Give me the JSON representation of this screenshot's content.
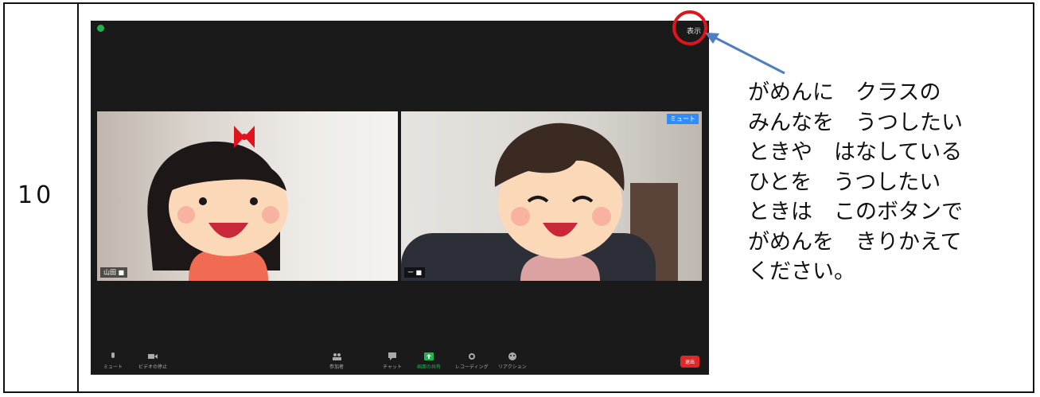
{
  "step": {
    "number": "10"
  },
  "zoom": {
    "view_switch_label": "表示",
    "participants": [
      {
        "name": "山田 ■",
        "role": "girl"
      },
      {
        "name": "ー  ■",
        "role": "boy",
        "badge": "ミュート"
      }
    ],
    "toolbar": {
      "items": [
        {
          "label": "ミュート",
          "icon": "microphone-icon"
        },
        {
          "label": "ビデオの停止",
          "icon": "video-camera-icon"
        },
        {
          "label": "参加者",
          "icon": "participants-icon"
        },
        {
          "label": "チャット",
          "icon": "chat-icon"
        },
        {
          "label": "画面の共有",
          "icon": "share-screen-icon"
        },
        {
          "label": "レコーディング",
          "icon": "record-icon"
        },
        {
          "label": "リアクション",
          "icon": "reaction-icon"
        }
      ],
      "participants_count": "2",
      "leave_label": "退出"
    },
    "colors": {
      "background": "#1a1a1a",
      "share": "#22b34a",
      "leave": "#e02828",
      "highlight": "#e0151a",
      "arrow": "#4f7fc0"
    }
  },
  "instruction": {
    "text": "がめんに　クラスの\nみんなを　うつしたい\nときや　はなしている\nひとを　うつしたい\nときは　このボタンで\nがめんを　きりかえて\nください。"
  }
}
